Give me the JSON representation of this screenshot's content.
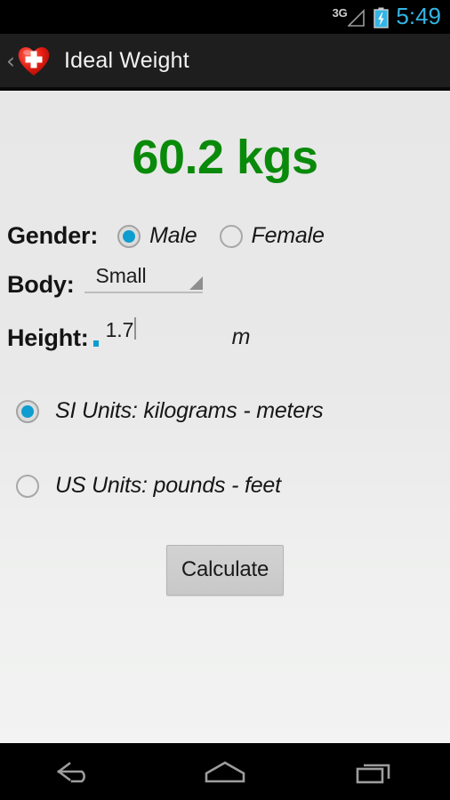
{
  "status_bar": {
    "network_label": "3G",
    "clock": "5:49",
    "signal_icon": "signal-triangle-icon",
    "battery_icon": "battery-charging-icon",
    "clock_color": "#33b5e5"
  },
  "action_bar": {
    "back_chevron": "‹",
    "app_icon": "heart-cross-icon",
    "title": "Ideal Weight"
  },
  "result": {
    "text": "60.2 kgs",
    "color": "#0a8a0a"
  },
  "form": {
    "gender": {
      "label": "Gender:",
      "options": [
        {
          "label": "Male",
          "selected": true
        },
        {
          "label": "Female",
          "selected": false
        }
      ]
    },
    "body": {
      "label": "Body:",
      "selected_value": "Small",
      "caret_icon": "spinner-triangle-icon"
    },
    "height": {
      "label": "Height:",
      "value": "1.7",
      "unit": "m"
    },
    "units": [
      {
        "label": "SI Units: kilograms - meters",
        "selected": true
      },
      {
        "label": "US Units: pounds - feet",
        "selected": false
      }
    ]
  },
  "calculate_button": {
    "label": "Calculate"
  },
  "nav_bar": {
    "back": "back-arrow-icon",
    "home": "home-icon",
    "recents": "recents-icon"
  },
  "colors": {
    "accent_blue": "#0d9dd0",
    "result_green": "#0a8a0a",
    "action_bar": "#1e1e1e",
    "content_bg": "#e9e9e9"
  }
}
